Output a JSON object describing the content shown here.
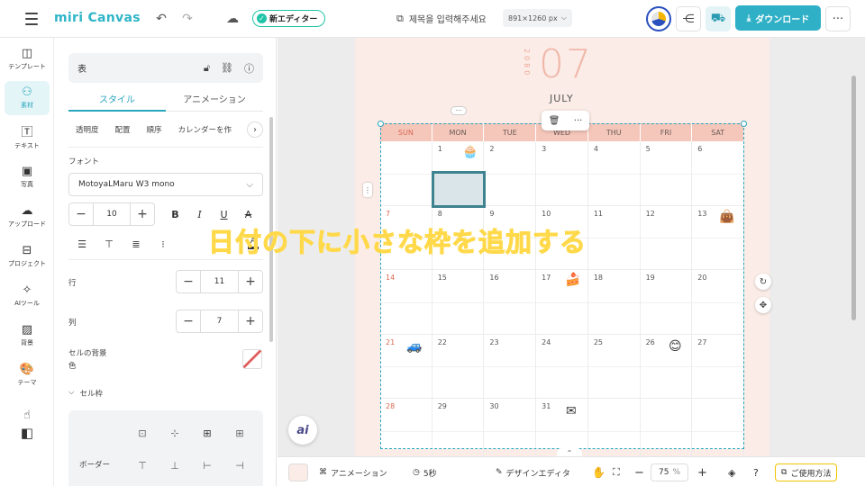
{
  "topbar": {
    "logo": "miri Canvas",
    "new_editor": "新エディター",
    "title_placeholder": "제목을 입력해주세요",
    "size": "891×1260 px",
    "download": "ダウンロード"
  },
  "sidebar": {
    "items": [
      {
        "label": "テンプレート",
        "icon": "template-icon"
      },
      {
        "label": "素材",
        "icon": "elements-icon"
      },
      {
        "label": "テキスト",
        "icon": "text-icon"
      },
      {
        "label": "写真",
        "icon": "photo-icon"
      },
      {
        "label": "アップロード",
        "icon": "upload-icon"
      },
      {
        "label": "プロジェクト",
        "icon": "project-icon"
      },
      {
        "label": "AIツール",
        "icon": "ai-tool-icon"
      },
      {
        "label": "背景",
        "icon": "background-icon"
      },
      {
        "label": "テーマ",
        "icon": "theme-icon"
      }
    ]
  },
  "panel": {
    "title": "表",
    "tabs": [
      "スタイル",
      "アニメーション"
    ],
    "subtabs": [
      "透明度",
      "配置",
      "順序",
      "カレンダーを作"
    ],
    "font_label": "フォント",
    "font_value": "MotoyaLMaru W3 mono",
    "font_size": "10",
    "rows_label": "行",
    "rows_value": "11",
    "cols_label": "列",
    "cols_value": "7",
    "cell_bg_label_1": "セルの背景",
    "cell_bg_label_2": "色",
    "cell_border_label": "セル枠",
    "border_label": "ボーダー"
  },
  "canvas": {
    "year": "2080",
    "month_num": "07",
    "month_name": "JULY",
    "weekdays": [
      "SUN",
      "MON",
      "TUE",
      "WED",
      "THU",
      "FRI",
      "SAT"
    ],
    "weeks": [
      [
        "",
        "1",
        "2",
        "3",
        "4",
        "5",
        "6"
      ],
      [
        "7",
        "8",
        "9",
        "10",
        "11",
        "12",
        "13"
      ],
      [
        "14",
        "15",
        "16",
        "17",
        "18",
        "19",
        "20"
      ],
      [
        "21",
        "22",
        "23",
        "24",
        "25",
        "26",
        "27"
      ],
      [
        "28",
        "29",
        "30",
        "31",
        "",
        "",
        ""
      ]
    ],
    "overlay_text": "日付の下に小さな枠を追加する",
    "ai_label": "ai"
  },
  "bottombar": {
    "animation": "アニメーション",
    "duration": "5秒",
    "design_editor": "デザインエディタ",
    "zoom": "75",
    "zoom_unit": "%",
    "help": "ご使用方法"
  },
  "colors": {
    "accent": "#2fb0c7",
    "page_bg": "#fbece7",
    "header_bg": "#f5c7bb",
    "overlay": "#ffd94a"
  }
}
